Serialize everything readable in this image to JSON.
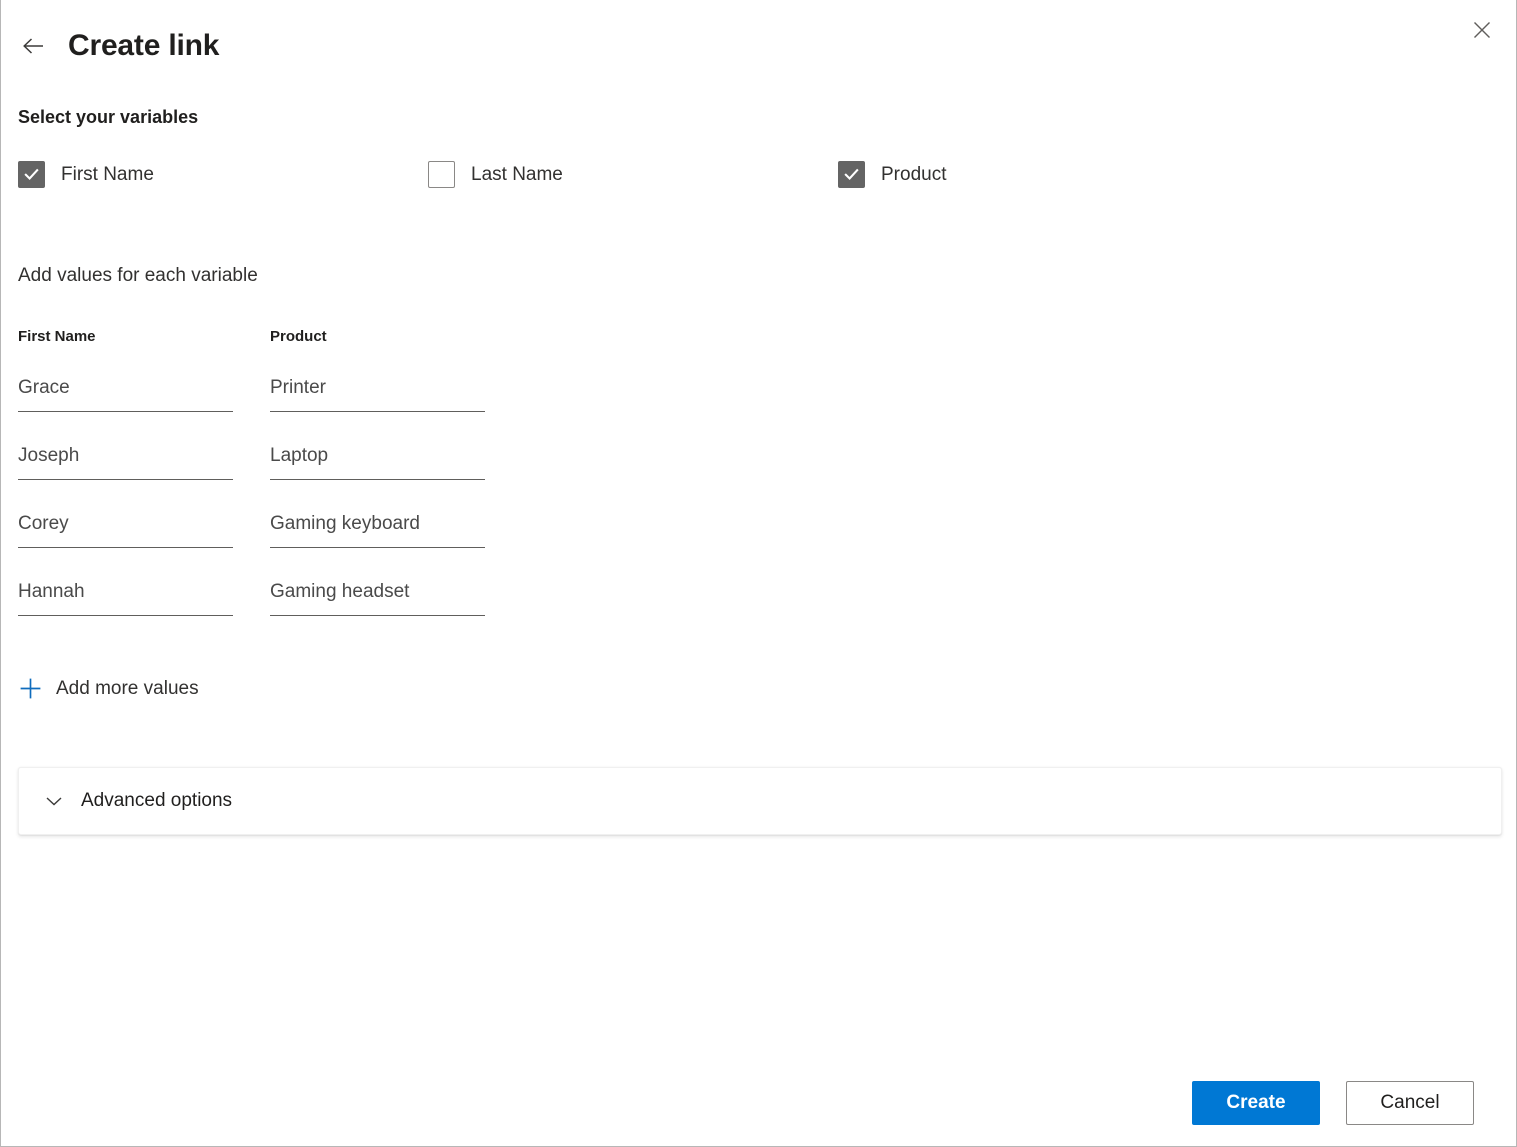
{
  "header": {
    "title": "Create link",
    "back_icon": "arrow-left-icon",
    "close_icon": "close-icon"
  },
  "variables_section": {
    "heading": "Select your variables",
    "checkboxes": [
      {
        "label": "First Name",
        "checked": true
      },
      {
        "label": "Last Name",
        "checked": false
      },
      {
        "label": "Product",
        "checked": true
      }
    ]
  },
  "values_section": {
    "heading": "Add values for each variable",
    "columns": [
      {
        "header": "First Name",
        "values": [
          "Grace",
          "Joseph",
          "Corey",
          "Hannah"
        ]
      },
      {
        "header": "Product",
        "values": [
          "Printer",
          "Laptop",
          "Gaming keyboard",
          "Gaming headset"
        ]
      }
    ],
    "add_more_label": "Add more values",
    "add_more_icon": "plus-icon"
  },
  "advanced": {
    "label": "Advanced options",
    "icon": "chevron-down-icon"
  },
  "footer": {
    "create_label": "Create",
    "cancel_label": "Cancel"
  },
  "colors": {
    "accent": "#0078d4",
    "checkbox_checked": "#646464",
    "text_primary": "#201f1e",
    "text_secondary": "#323130",
    "field_underline": "#605e5c"
  }
}
